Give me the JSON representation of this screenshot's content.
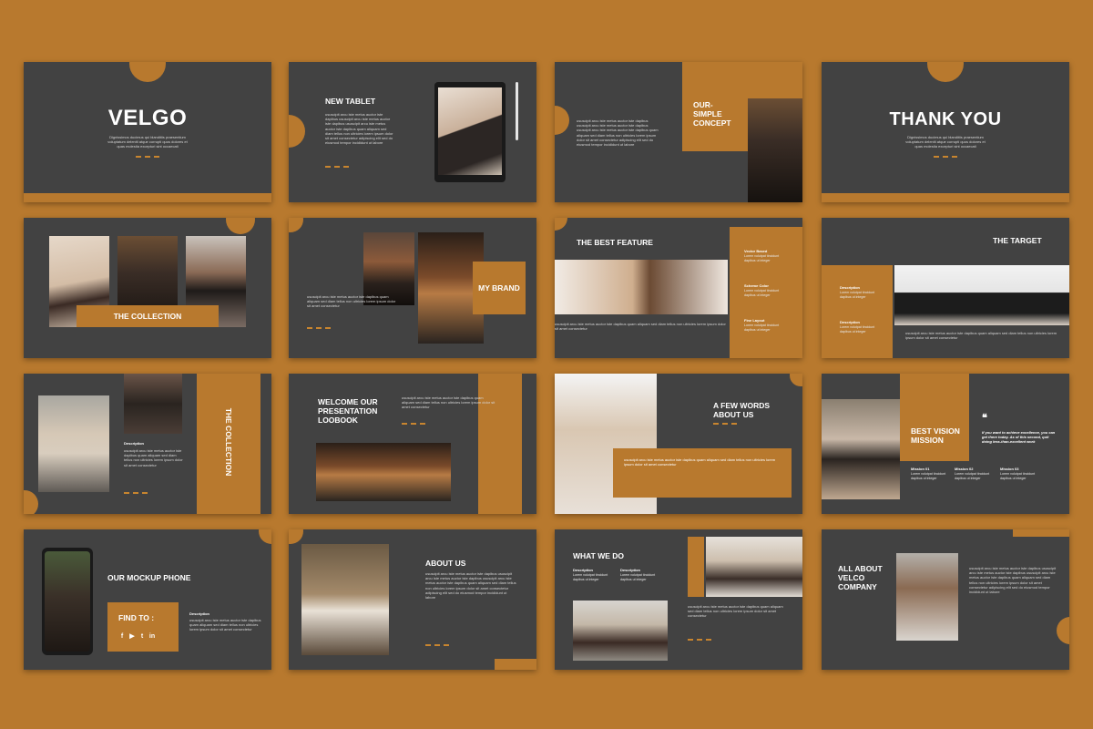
{
  "lorem": {
    "block": "ususcipit arcu iste metus auctor iste dapibus ususcipit arcu iste metus auctor iste dapibus ususcipit arcu iste metus auctor iste dapibus quam aliquam sed diam tellus non ultricies lorem ipsum dolor sit amet consectetur adipiscing elit sed do eiusmod tempor incididunt ut labore",
    "block_short": "ususcipit arcu iste metus auctor iste dapibus quam aliquam sed diam tellus non ultricies lorem ipsum dolor sit amet consectetur",
    "intro": "Dignissimos ducimus qui blanditiis praesentium voluptatum deleniti atque corrupti quos dolores et quas molestia excepturi sint occaecati",
    "desc": "Lorem volutpat tincidunt dapibus ut integer"
  },
  "slides": {
    "s1": {
      "title": "VELGO"
    },
    "s2": {
      "title": "NEW TABLET"
    },
    "s3": {
      "title": "OUR-\nSIMPLE\nCONCEPT"
    },
    "s4": {
      "title": "THANK YOU"
    },
    "s5": {
      "title": "THE COLLECTION"
    },
    "s6": {
      "title": "MY BRAND"
    },
    "s7": {
      "title": "THE BEST FEATURE",
      "items": [
        "Vector Based",
        "Scheme Color",
        "Fine Layout"
      ]
    },
    "s8": {
      "title": "THE TARGET",
      "items": [
        "Description",
        "Description"
      ]
    },
    "s9": {
      "title": "THE COLLECTION",
      "label": "Description"
    },
    "s10": {
      "title": "WELCOME OUR\nPRESENTATION\nLOOBOOK"
    },
    "s11": {
      "title": "A FEW WORDS\nABOUT US"
    },
    "s12": {
      "title": "BEST VISION\nMISSION",
      "quote": "If you want to achieve excellence, you can get there today. As of this second, quit doing less-than-excellent work",
      "items": [
        "Mission 01",
        "Mission 02",
        "Mission 03"
      ]
    },
    "s13": {
      "title": "OUR MOCKUP PHONE",
      "find": "FIND TO :",
      "label": "Description",
      "social": [
        "f",
        "▶",
        "t",
        "in"
      ]
    },
    "s14": {
      "title": "ABOUT US"
    },
    "s15": {
      "title": "WHAT WE DO",
      "items": [
        "Description",
        "Description"
      ]
    },
    "s16": {
      "title": "ALL ABOUT\nVELCO\nCOMPANY"
    }
  },
  "colors": {
    "accent": "#b8792e",
    "slide": "#424242"
  }
}
